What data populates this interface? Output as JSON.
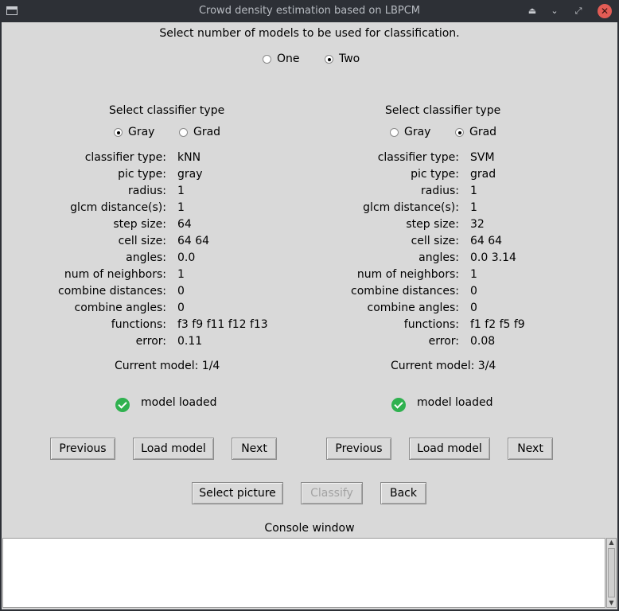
{
  "window": {
    "title": "Crowd density estimation based on LBPCM",
    "controls": [
      "⏏",
      "⌄",
      "⤢",
      "✕"
    ]
  },
  "prompt": "Select number of models to be used for classification.",
  "num_models": {
    "options": [
      "One",
      "Two"
    ],
    "selected": "Two"
  },
  "classifiers": [
    {
      "heading": "Select classifier type",
      "type_options": [
        "Gray",
        "Grad"
      ],
      "type_selected": "Gray",
      "fields": [
        {
          "label": "classifier type:",
          "value": "kNN"
        },
        {
          "label": "pic type:",
          "value": "gray"
        },
        {
          "label": "radius:",
          "value": "1"
        },
        {
          "label": "glcm distance(s):",
          "value": "1"
        },
        {
          "label": "step size:",
          "value": "64"
        },
        {
          "label": "cell size:",
          "value": "64 64"
        },
        {
          "label": "angles:",
          "value": "0.0"
        },
        {
          "label": "num of neighbors:",
          "value": "1"
        },
        {
          "label": "combine distances:",
          "value": "0"
        },
        {
          "label": "combine angles:",
          "value": "0"
        },
        {
          "label": "functions:",
          "value": "f3 f9 f11 f12 f13"
        },
        {
          "label": "error:",
          "value": "0.11"
        }
      ],
      "current_model": "Current model: 1/4",
      "status": "model loaded",
      "buttons": {
        "previous": "Previous",
        "load": "Load model",
        "next": "Next"
      }
    },
    {
      "heading": "Select classifier type",
      "type_options": [
        "Gray",
        "Grad"
      ],
      "type_selected": "Grad",
      "fields": [
        {
          "label": "classifier type:",
          "value": "SVM"
        },
        {
          "label": "pic type:",
          "value": "grad"
        },
        {
          "label": "radius:",
          "value": "1"
        },
        {
          "label": "glcm distance(s):",
          "value": "1"
        },
        {
          "label": "step size:",
          "value": "32"
        },
        {
          "label": "cell size:",
          "value": "64 64"
        },
        {
          "label": "angles:",
          "value": "0.0 3.14"
        },
        {
          "label": "num of neighbors:",
          "value": "1"
        },
        {
          "label": "combine distances:",
          "value": "0"
        },
        {
          "label": "combine angles:",
          "value": "0"
        },
        {
          "label": "functions:",
          "value": "f1 f2 f5 f9"
        },
        {
          "label": "error:",
          "value": "0.08"
        }
      ],
      "current_model": "Current model: 3/4",
      "status": "model loaded",
      "buttons": {
        "previous": "Previous",
        "load": "Load model",
        "next": "Next"
      }
    }
  ],
  "actions": {
    "select_picture": "Select picture",
    "classify": "Classify",
    "back": "Back"
  },
  "console": {
    "label": "Console window",
    "text": ""
  },
  "colors": {
    "titlebar": "#2d3036",
    "window_bg": "#d9d9d9",
    "close_button": "#e25c55",
    "status_ok": "#2fb14f",
    "disabled_text": "#a3a3a3"
  }
}
